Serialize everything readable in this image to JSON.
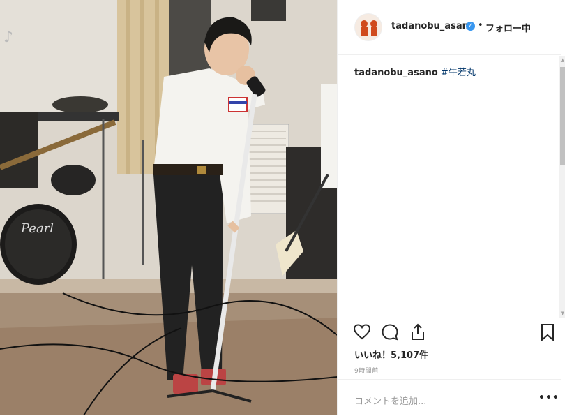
{
  "post": {
    "image_alt": "Vintage photo of a young singer performing on stage with a microphone stand and band",
    "drum_brand": "Pearl"
  },
  "header": {
    "username": "tadanobu_asano",
    "separator": "•",
    "follow_label": "フォロー中"
  },
  "caption": {
    "username": "tadanobu_asano",
    "hashtag": "#牛若丸"
  },
  "actions": {
    "like_icon": "heart-icon",
    "comment_icon": "comment-icon",
    "share_icon": "share-icon",
    "save_icon": "bookmark-icon"
  },
  "likes": {
    "label": "いいね！5,107件"
  },
  "timestamp": "9時間前",
  "comment": {
    "placeholder": "コメントを追加...",
    "more": "•••"
  },
  "colors": {
    "link": "#003569",
    "verified": "#3897f0",
    "border": "#efefef"
  }
}
